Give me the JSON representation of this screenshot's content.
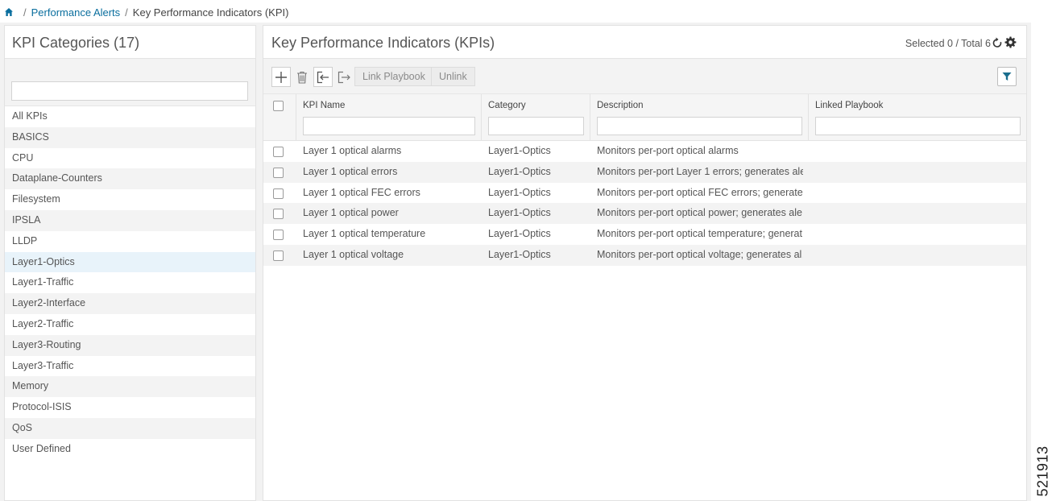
{
  "breadcrumb": {
    "items": [
      "Performance Alerts",
      "Key Performance Indicators (KPI)"
    ]
  },
  "left_panel": {
    "title": "KPI Categories (17)",
    "search_value": "",
    "categories": [
      "All KPIs",
      "BASICS",
      "CPU",
      "Dataplane-Counters",
      "Filesystem",
      "IPSLA",
      "LLDP",
      "Layer1-Optics",
      "Layer1-Traffic",
      "Layer2-Interface",
      "Layer2-Traffic",
      "Layer3-Routing",
      "Layer3-Traffic",
      "Memory",
      "Protocol-ISIS",
      "QoS",
      "User Defined"
    ],
    "selected_category": "Layer1-Optics"
  },
  "main": {
    "title": "Key Performance Indicators (KPIs)",
    "selection_info": "Selected 0 / Total 6",
    "toolbar": {
      "link_playbook_label": "Link Playbook",
      "unlink_label": "Unlink"
    },
    "columns": [
      "KPI Name",
      "Category",
      "Description",
      "Linked Playbook"
    ],
    "rows": [
      {
        "name": "Layer 1 optical alarms",
        "category": "Layer1-Optics",
        "description": "Monitors per-port optical alarms",
        "playbook": ""
      },
      {
        "name": "Layer 1 optical errors",
        "category": "Layer1-Optics",
        "description": "Monitors per-port Layer 1 errors; generates ale…",
        "playbook": ""
      },
      {
        "name": "Layer 1 optical FEC errors",
        "category": "Layer1-Optics",
        "description": "Monitors per-port optical FEC errors; generate…",
        "playbook": ""
      },
      {
        "name": "Layer 1 optical power",
        "category": "Layer1-Optics",
        "description": "Monitors per-port optical power; generates ale…",
        "playbook": ""
      },
      {
        "name": "Layer 1 optical temperature",
        "category": "Layer1-Optics",
        "description": "Monitors per-port optical temperature; generat…",
        "playbook": ""
      },
      {
        "name": "Layer 1 optical voltage",
        "category": "Layer1-Optics",
        "description": "Monitors per-port optical voltage; generates al…",
        "playbook": ""
      }
    ]
  },
  "side_label": "521913",
  "colors": {
    "link": "#0a6e9e",
    "selected_row": "#e8f3fa",
    "filter_icon": "#1a6e8e"
  },
  "icons": [
    "home-icon",
    "refresh-icon",
    "gear-icon",
    "add-icon",
    "delete-icon",
    "import-icon",
    "export-icon",
    "filter-icon"
  ]
}
